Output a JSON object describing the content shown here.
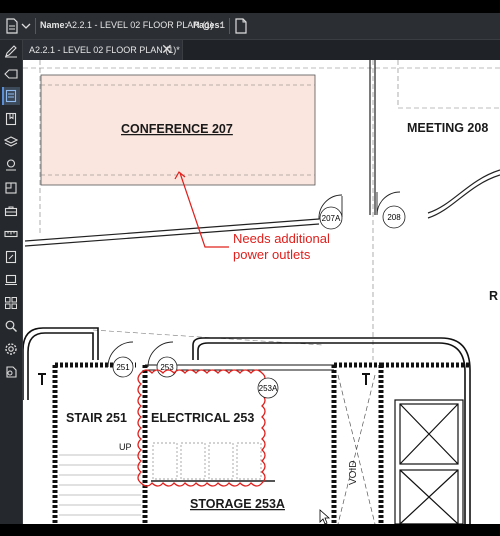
{
  "topbar": {
    "name_label": "Name:",
    "file_name": "A2.2.1 - LEVEL 02 FLOOR PLAN (1)",
    "pages_label": "Pages:",
    "pages_value": "1"
  },
  "tab": {
    "label": "A2.2.1 - LEVEL 02 FLOOR PLAN (1)*",
    "close": "✕"
  },
  "sidebar": {
    "items": [
      "markup-pen-icon",
      "eraser-icon",
      "pages-icon",
      "bookmarks-icon",
      "layers-icon",
      "places-icon",
      "sheets-icon",
      "toolbox-icon",
      "measurements-icon",
      "markups-list-icon",
      "studio-icon",
      "thumbnails-icon",
      "search-icon",
      "settings-icon",
      "properties-icon"
    ],
    "active_index": 2
  },
  "drawing": {
    "rooms": {
      "conference": "CONFERENCE   207",
      "meeting": "MEETING   208",
      "stair": "STAIR   251",
      "electrical": "ELECTRICAL   253",
      "storage": "STORAGE   253A",
      "void": "VOID",
      "up": "UP",
      "partial_r": "R"
    },
    "tags": {
      "t207a": "207A",
      "t208": "208",
      "t251": "251",
      "t253": "253",
      "t253a": "253A"
    },
    "callout": {
      "line1": "Needs additional",
      "line2": "power outlets",
      "color": "#e0201c"
    },
    "highlight_color": "#fbe6df",
    "cloud_color": "#e0201c"
  }
}
